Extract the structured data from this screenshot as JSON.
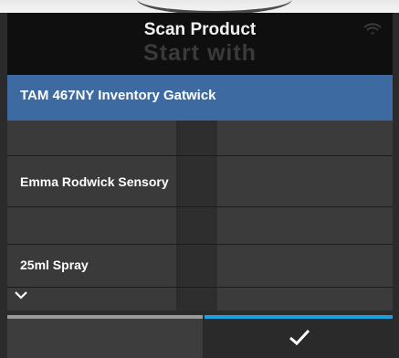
{
  "header": {
    "title": "Scan Product",
    "subtitle": "Start with"
  },
  "selected_item": {
    "label": "TAM 467NY Inventory Gatwick"
  },
  "list": {
    "rows": [
      {
        "label": ""
      },
      {
        "label": "Emma Rodwick Sensory"
      },
      {
        "label": ""
      },
      {
        "label": "25ml Spray"
      }
    ]
  },
  "icons": {
    "status": "wifi-icon",
    "expand": "chevron-down-icon",
    "confirm": "checkmark-icon"
  },
  "colors": {
    "selected_row": "#3d6aa0",
    "confirm_accent": "#1aa0e0",
    "cancel_accent": "#9a9a9a"
  }
}
